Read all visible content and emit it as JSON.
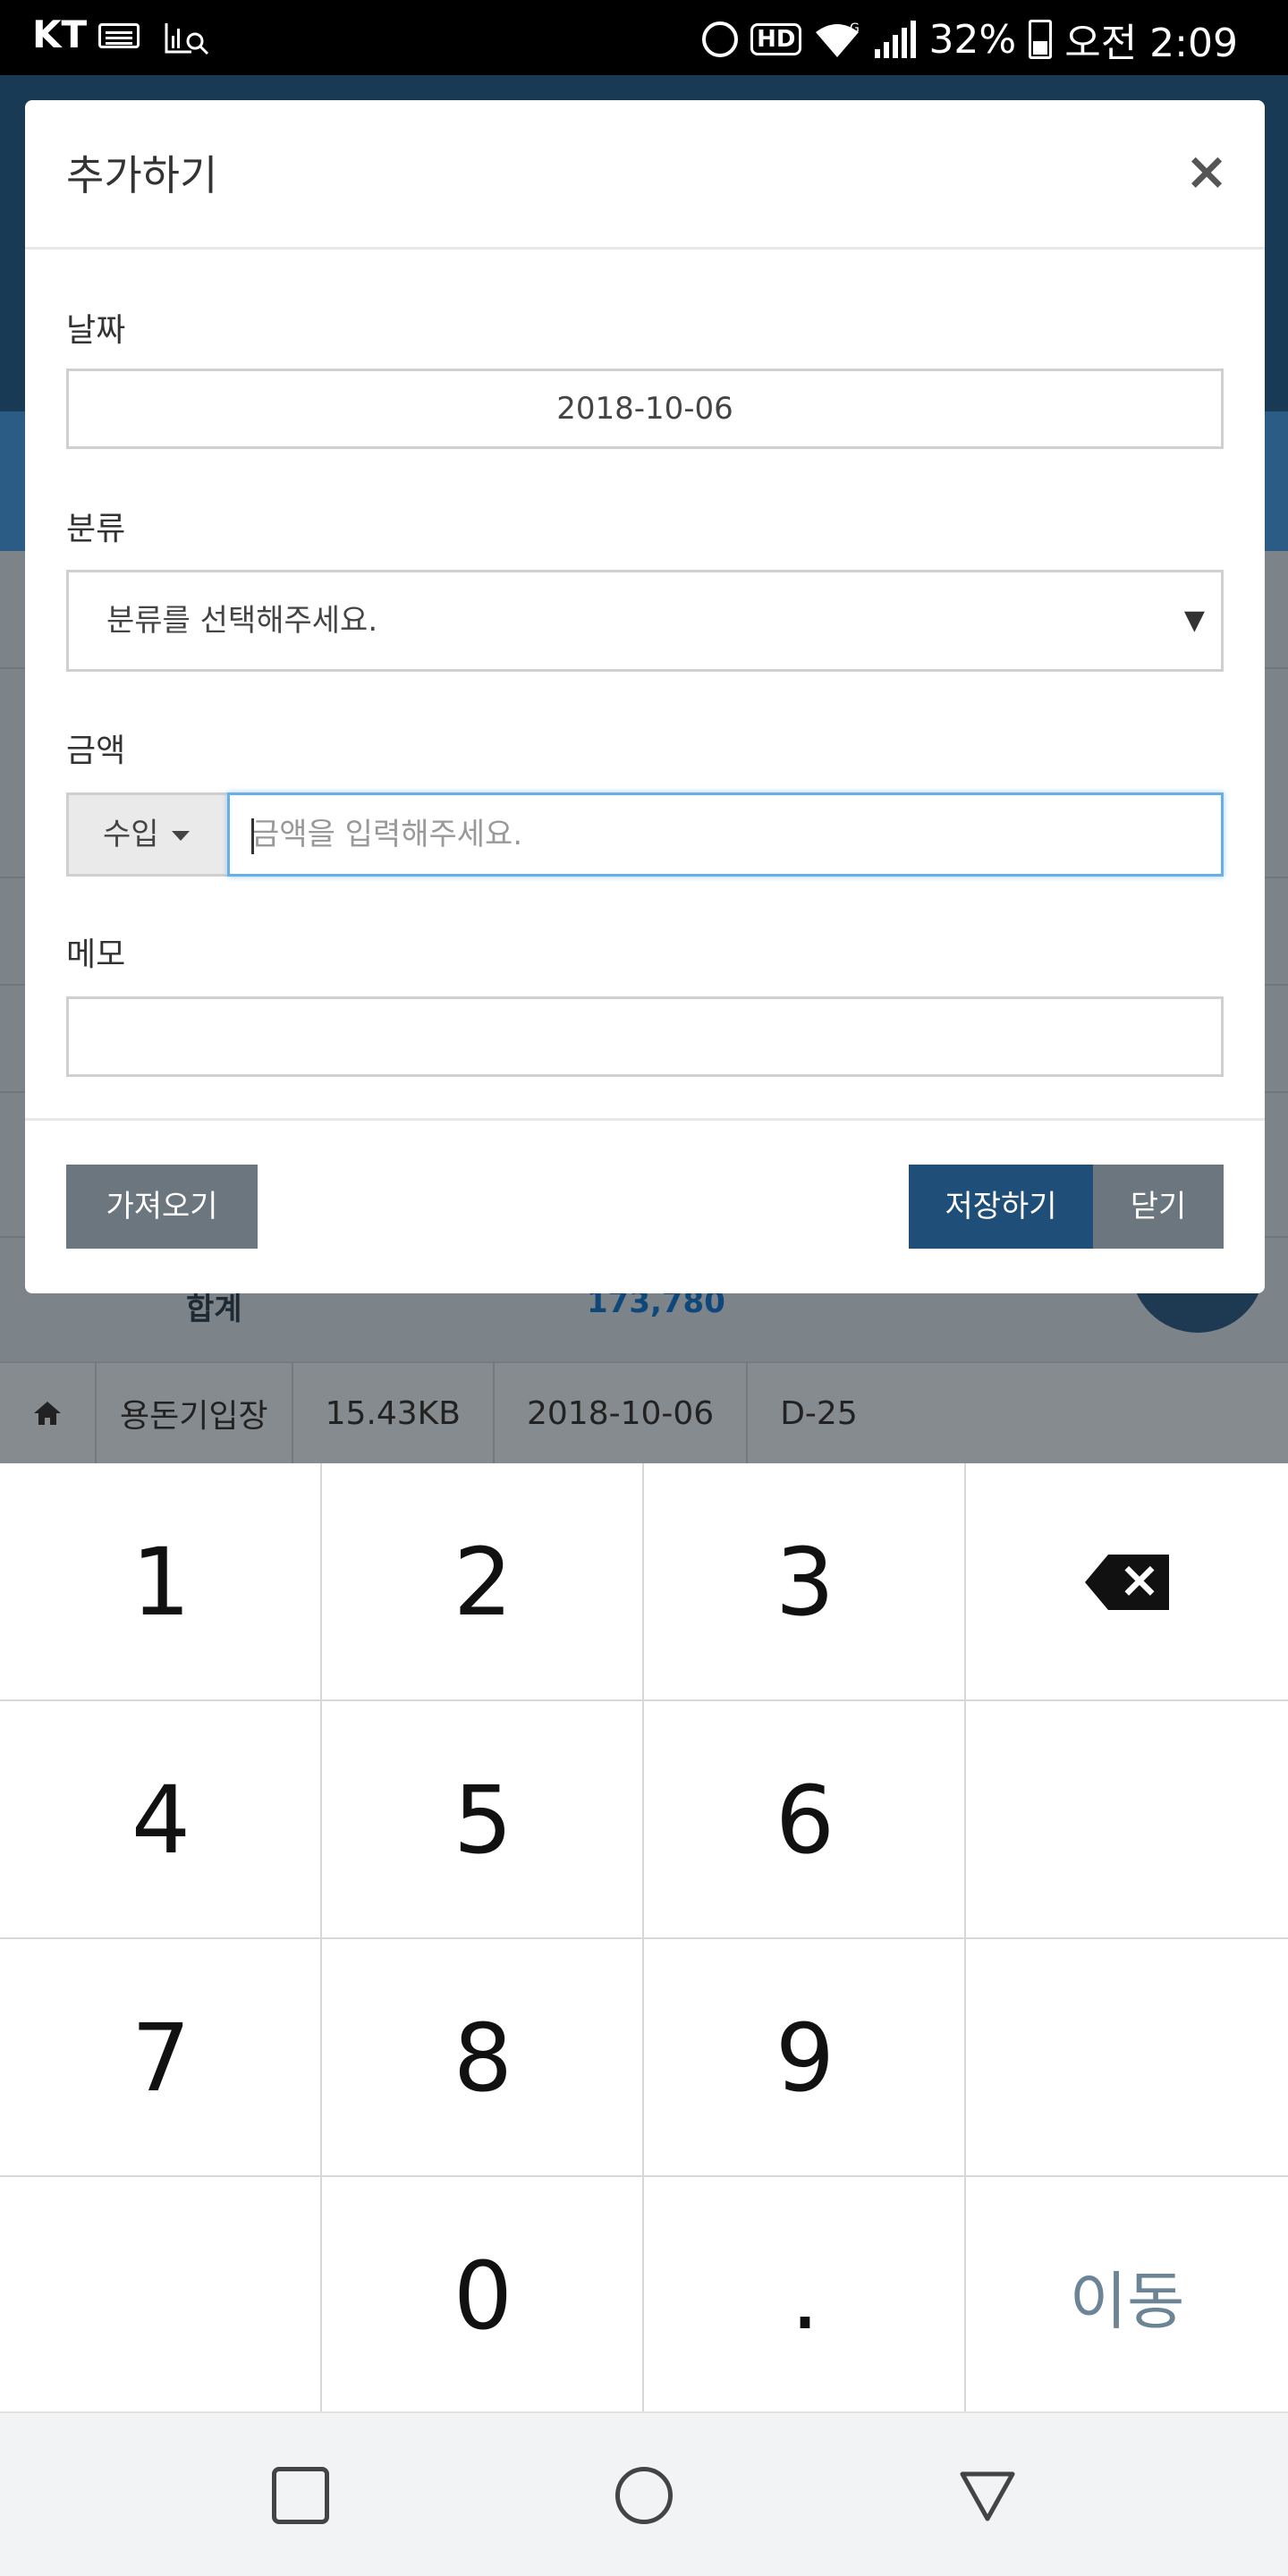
{
  "status_bar": {
    "carrier": "KT",
    "battery": "32%",
    "time": "오전 2:09",
    "hd_badge": "HD",
    "network_badge": "G",
    "icons": [
      "keyboard-icon",
      "screen-search-icon",
      "alarm-icon",
      "hd-icon",
      "wifi-icon",
      "signal-icon",
      "battery-icon"
    ]
  },
  "background_page": {
    "total_label": "합계",
    "total_value": "173,780",
    "footer": {
      "home_icon": "home-icon",
      "title": "용돈기입장",
      "size": "15.43KB",
      "date": "2018-10-06",
      "dday": "D-25"
    }
  },
  "modal": {
    "title": "추가하기",
    "close_icon": "close-icon",
    "date_label": "날짜",
    "date_value": "2018-10-06",
    "category_label": "분류",
    "category_placeholder": "분류를 선택해주세요.",
    "amount_label": "금액",
    "amount_type": "수입",
    "amount_placeholder": "금액을 입력해주세요.",
    "memo_label": "메모",
    "memo_value": "",
    "buttons": {
      "load": "가져오기",
      "save": "저장하기",
      "close": "닫기"
    },
    "colors": {
      "primary": "#1f4e79",
      "secondary": "#6c767e",
      "focus_border": "#66afe9"
    }
  },
  "keypad": {
    "keys": [
      "1",
      "2",
      "3",
      "⌫",
      "4",
      "5",
      "6",
      "",
      "7",
      "8",
      "9",
      "",
      "",
      "0",
      ".",
      "이동"
    ],
    "go_label": "이동",
    "go_color": "#6b8496"
  },
  "nav_bar": {
    "icons": [
      "recents-icon",
      "home-icon",
      "back-icon"
    ]
  }
}
